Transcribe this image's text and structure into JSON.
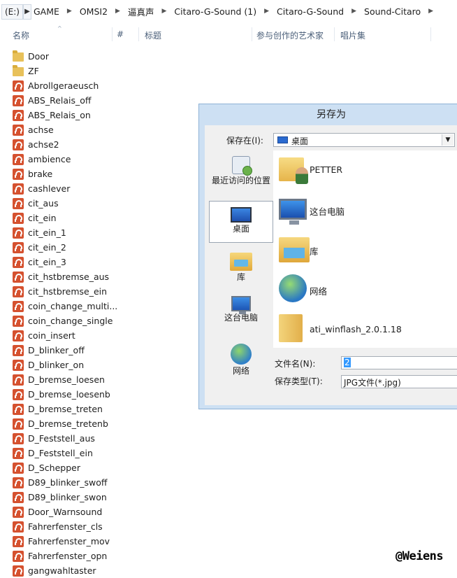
{
  "breadcrumb": {
    "root": "(E:)",
    "items": [
      "GAME",
      "OMSI2",
      "逼真声",
      "Citaro-G-Sound (1)",
      "Citaro-G-Sound",
      "Sound-Citaro"
    ]
  },
  "columns": {
    "name": "名称",
    "number": "#",
    "title": "标题",
    "artist": "参与创作的艺术家",
    "album": "唱片集"
  },
  "files": [
    {
      "name": "Door",
      "type": "folder"
    },
    {
      "name": "ZF",
      "type": "folder"
    },
    {
      "name": "Abrollgeraeusch",
      "type": "audio"
    },
    {
      "name": "ABS_Relais_off",
      "type": "audio"
    },
    {
      "name": "ABS_Relais_on",
      "type": "audio"
    },
    {
      "name": "achse",
      "type": "audio"
    },
    {
      "name": "achse2",
      "type": "audio"
    },
    {
      "name": "ambience",
      "type": "audio"
    },
    {
      "name": "brake",
      "type": "audio"
    },
    {
      "name": "cashlever",
      "type": "audio"
    },
    {
      "name": "cit_aus",
      "type": "audio"
    },
    {
      "name": "cit_ein",
      "type": "audio"
    },
    {
      "name": "cit_ein_1",
      "type": "audio"
    },
    {
      "name": "cit_ein_2",
      "type": "audio"
    },
    {
      "name": "cit_ein_3",
      "type": "audio"
    },
    {
      "name": "cit_hstbremse_aus",
      "type": "audio"
    },
    {
      "name": "cit_hstbremse_ein",
      "type": "audio"
    },
    {
      "name": "coin_change_multi...",
      "type": "audio"
    },
    {
      "name": "coin_change_single",
      "type": "audio"
    },
    {
      "name": "coin_insert",
      "type": "audio"
    },
    {
      "name": "D_blinker_off",
      "type": "audio"
    },
    {
      "name": "D_blinker_on",
      "type": "audio"
    },
    {
      "name": "D_bremse_loesen",
      "type": "audio"
    },
    {
      "name": "D_bremse_loesenb",
      "type": "audio"
    },
    {
      "name": "D_bremse_treten",
      "type": "audio"
    },
    {
      "name": "D_bremse_tretenb",
      "type": "audio"
    },
    {
      "name": "D_Feststell_aus",
      "type": "audio"
    },
    {
      "name": "D_Feststell_ein",
      "type": "audio"
    },
    {
      "name": "D_Schepper",
      "type": "audio"
    },
    {
      "name": "D89_blinker_swoff",
      "type": "audio"
    },
    {
      "name": "D89_blinker_swon",
      "type": "audio"
    },
    {
      "name": "Door_Warnsound",
      "type": "audio"
    },
    {
      "name": "Fahrerfenster_cls",
      "type": "audio"
    },
    {
      "name": "Fahrerfenster_mov",
      "type": "audio"
    },
    {
      "name": "Fahrerfenster_opn",
      "type": "audio"
    },
    {
      "name": "gangwahltaster",
      "type": "audio"
    }
  ],
  "dialog": {
    "title": "另存为",
    "save_in_label": "保存在(I):",
    "save_in_value": "桌面",
    "places": [
      {
        "label": "最近访问的位置",
        "icon": "recent-places-icon"
      },
      {
        "label": "桌面",
        "icon": "desktop-icon",
        "selected": true
      },
      {
        "label": "库",
        "icon": "libraries-icon"
      },
      {
        "label": "这台电脑",
        "icon": "this-pc-icon"
      },
      {
        "label": "网络",
        "icon": "network-icon"
      }
    ],
    "items": [
      {
        "label": "PETTER",
        "icon": "user-folder-icon"
      },
      {
        "label": "这台电脑",
        "icon": "this-pc-icon"
      },
      {
        "label": "库",
        "icon": "libraries-icon"
      },
      {
        "label": "网络",
        "icon": "network-icon"
      },
      {
        "label": "ati_winflash_2.0.1.18",
        "icon": "folder-icon"
      }
    ],
    "filename_label": "文件名(N):",
    "filename_value": "2",
    "filetype_label": "保存类型(T):",
    "filetype_value": "JPG文件(*.jpg)"
  },
  "watermark": "@Weiens"
}
